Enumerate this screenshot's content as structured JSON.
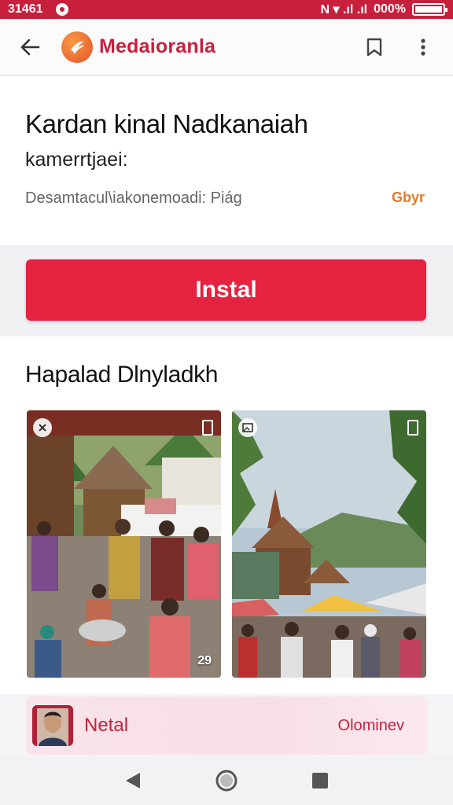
{
  "status_bar": {
    "time": "31461",
    "signal": "N ▾ .ıl .ıl",
    "battery_text": "000%",
    "battery_level": 1.0,
    "color": "#c8203c"
  },
  "app_bar": {
    "app_name": "Medaioranla",
    "icons": {
      "back": "back-arrow-icon",
      "logo": "app-logo-icon",
      "bookmark": "bookmark-icon",
      "more": "more-vert-icon"
    }
  },
  "details": {
    "title": "Kardan kinal Nadkanaiah",
    "subtitle": "kamerrtjaei:",
    "meta": "Desamtacul\\iakonemoadi: Piág",
    "meta_link": "Gbyr"
  },
  "install": {
    "label": "Instal",
    "color": "#e5223f"
  },
  "gallery": {
    "title": "Hapalad Dlnyladkh",
    "thumbnails": [
      {
        "badge_icon": "close-icon",
        "count": "29"
      },
      {
        "badge_icon": "image-icon",
        "count": ""
      }
    ]
  },
  "promo": {
    "label": "Netal",
    "right_text": "Olominev"
  },
  "nav_bar": {
    "icons": [
      "back-triangle-icon",
      "home-circle-icon",
      "recents-square-icon"
    ]
  }
}
